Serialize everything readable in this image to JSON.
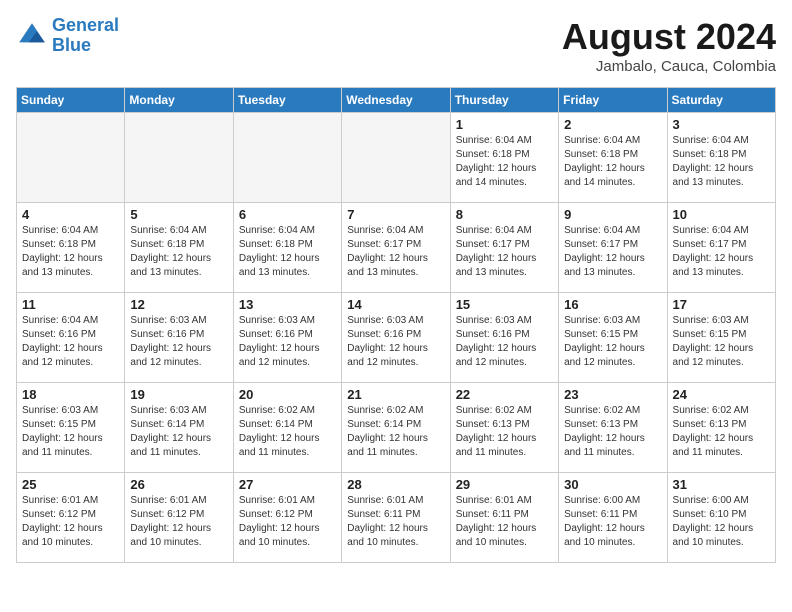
{
  "header": {
    "logo_line1": "General",
    "logo_line2": "Blue",
    "month_title": "August 2024",
    "subtitle": "Jambalo, Cauca, Colombia"
  },
  "weekdays": [
    "Sunday",
    "Monday",
    "Tuesday",
    "Wednesday",
    "Thursday",
    "Friday",
    "Saturday"
  ],
  "weeks": [
    [
      {
        "day": "",
        "info": ""
      },
      {
        "day": "",
        "info": ""
      },
      {
        "day": "",
        "info": ""
      },
      {
        "day": "",
        "info": ""
      },
      {
        "day": "1",
        "info": "Sunrise: 6:04 AM\nSunset: 6:18 PM\nDaylight: 12 hours\nand 14 minutes."
      },
      {
        "day": "2",
        "info": "Sunrise: 6:04 AM\nSunset: 6:18 PM\nDaylight: 12 hours\nand 14 minutes."
      },
      {
        "day": "3",
        "info": "Sunrise: 6:04 AM\nSunset: 6:18 PM\nDaylight: 12 hours\nand 13 minutes."
      }
    ],
    [
      {
        "day": "4",
        "info": "Sunrise: 6:04 AM\nSunset: 6:18 PM\nDaylight: 12 hours\nand 13 minutes."
      },
      {
        "day": "5",
        "info": "Sunrise: 6:04 AM\nSunset: 6:18 PM\nDaylight: 12 hours\nand 13 minutes."
      },
      {
        "day": "6",
        "info": "Sunrise: 6:04 AM\nSunset: 6:18 PM\nDaylight: 12 hours\nand 13 minutes."
      },
      {
        "day": "7",
        "info": "Sunrise: 6:04 AM\nSunset: 6:17 PM\nDaylight: 12 hours\nand 13 minutes."
      },
      {
        "day": "8",
        "info": "Sunrise: 6:04 AM\nSunset: 6:17 PM\nDaylight: 12 hours\nand 13 minutes."
      },
      {
        "day": "9",
        "info": "Sunrise: 6:04 AM\nSunset: 6:17 PM\nDaylight: 12 hours\nand 13 minutes."
      },
      {
        "day": "10",
        "info": "Sunrise: 6:04 AM\nSunset: 6:17 PM\nDaylight: 12 hours\nand 13 minutes."
      }
    ],
    [
      {
        "day": "11",
        "info": "Sunrise: 6:04 AM\nSunset: 6:16 PM\nDaylight: 12 hours\nand 12 minutes."
      },
      {
        "day": "12",
        "info": "Sunrise: 6:03 AM\nSunset: 6:16 PM\nDaylight: 12 hours\nand 12 minutes."
      },
      {
        "day": "13",
        "info": "Sunrise: 6:03 AM\nSunset: 6:16 PM\nDaylight: 12 hours\nand 12 minutes."
      },
      {
        "day": "14",
        "info": "Sunrise: 6:03 AM\nSunset: 6:16 PM\nDaylight: 12 hours\nand 12 minutes."
      },
      {
        "day": "15",
        "info": "Sunrise: 6:03 AM\nSunset: 6:16 PM\nDaylight: 12 hours\nand 12 minutes."
      },
      {
        "day": "16",
        "info": "Sunrise: 6:03 AM\nSunset: 6:15 PM\nDaylight: 12 hours\nand 12 minutes."
      },
      {
        "day": "17",
        "info": "Sunrise: 6:03 AM\nSunset: 6:15 PM\nDaylight: 12 hours\nand 12 minutes."
      }
    ],
    [
      {
        "day": "18",
        "info": "Sunrise: 6:03 AM\nSunset: 6:15 PM\nDaylight: 12 hours\nand 11 minutes."
      },
      {
        "day": "19",
        "info": "Sunrise: 6:03 AM\nSunset: 6:14 PM\nDaylight: 12 hours\nand 11 minutes."
      },
      {
        "day": "20",
        "info": "Sunrise: 6:02 AM\nSunset: 6:14 PM\nDaylight: 12 hours\nand 11 minutes."
      },
      {
        "day": "21",
        "info": "Sunrise: 6:02 AM\nSunset: 6:14 PM\nDaylight: 12 hours\nand 11 minutes."
      },
      {
        "day": "22",
        "info": "Sunrise: 6:02 AM\nSunset: 6:13 PM\nDaylight: 12 hours\nand 11 minutes."
      },
      {
        "day": "23",
        "info": "Sunrise: 6:02 AM\nSunset: 6:13 PM\nDaylight: 12 hours\nand 11 minutes."
      },
      {
        "day": "24",
        "info": "Sunrise: 6:02 AM\nSunset: 6:13 PM\nDaylight: 12 hours\nand 11 minutes."
      }
    ],
    [
      {
        "day": "25",
        "info": "Sunrise: 6:01 AM\nSunset: 6:12 PM\nDaylight: 12 hours\nand 10 minutes."
      },
      {
        "day": "26",
        "info": "Sunrise: 6:01 AM\nSunset: 6:12 PM\nDaylight: 12 hours\nand 10 minutes."
      },
      {
        "day": "27",
        "info": "Sunrise: 6:01 AM\nSunset: 6:12 PM\nDaylight: 12 hours\nand 10 minutes."
      },
      {
        "day": "28",
        "info": "Sunrise: 6:01 AM\nSunset: 6:11 PM\nDaylight: 12 hours\nand 10 minutes."
      },
      {
        "day": "29",
        "info": "Sunrise: 6:01 AM\nSunset: 6:11 PM\nDaylight: 12 hours\nand 10 minutes."
      },
      {
        "day": "30",
        "info": "Sunrise: 6:00 AM\nSunset: 6:11 PM\nDaylight: 12 hours\nand 10 minutes."
      },
      {
        "day": "31",
        "info": "Sunrise: 6:00 AM\nSunset: 6:10 PM\nDaylight: 12 hours\nand 10 minutes."
      }
    ]
  ]
}
